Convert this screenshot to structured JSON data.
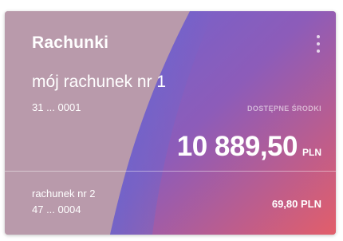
{
  "card": {
    "title": "Rachunki",
    "menu_icon": "more-vertical-icon",
    "main_account": {
      "name": "mój rachunek nr 1",
      "number": "31 ... 0001",
      "available_label": "DOSTĘPNE ŚRODKI",
      "balance": "10 889,50",
      "currency": "PLN"
    },
    "other_accounts": [
      {
        "name": "rachunek nr 2",
        "number": "47 ... 0004",
        "balance": "69,80 PLN"
      }
    ]
  },
  "colors": {
    "mauve": "#b99aab",
    "blue": "#5d66d4",
    "violet": "#9a5fb2",
    "pink": "#dd6070"
  }
}
